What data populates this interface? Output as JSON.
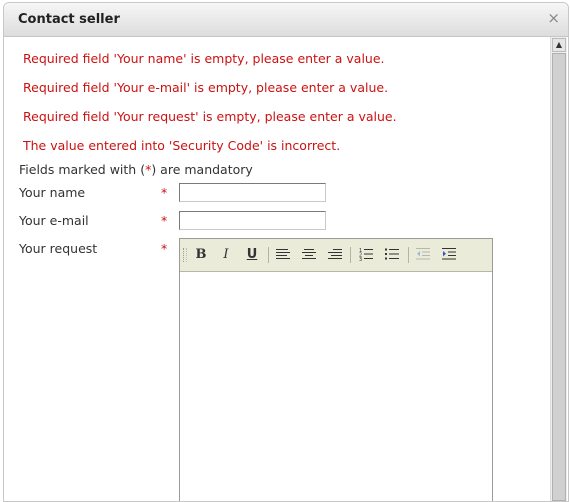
{
  "dialog": {
    "title": "Contact seller",
    "close_icon": "×"
  },
  "errors": [
    "Required field 'Your name' is empty, please enter a value.",
    "Required field 'Your e-mail' is empty, please enter a value.",
    "Required field 'Your request' is empty, please enter a value.",
    "The value entered into 'Security Code' is incorrect."
  ],
  "mandatory_note": {
    "before": "Fields marked with (",
    "star": "*",
    "after": ") are mandatory"
  },
  "form": {
    "required_mark": "*",
    "name_label": "Your name",
    "name_value": "",
    "email_label": "Your e-mail",
    "email_value": "",
    "request_label": "Your request",
    "request_value": ""
  },
  "toolbar": {
    "bold": "B",
    "italic": "I",
    "underline": "U",
    "icons": [
      "bold-icon",
      "italic-icon",
      "underline-icon",
      "align-left-icon",
      "align-center-icon",
      "align-right-icon",
      "ordered-list-icon",
      "unordered-list-icon",
      "outdent-icon",
      "indent-icon"
    ]
  },
  "colors": {
    "error": "#cc1111",
    "toolbar_bg": "#ebebda"
  }
}
